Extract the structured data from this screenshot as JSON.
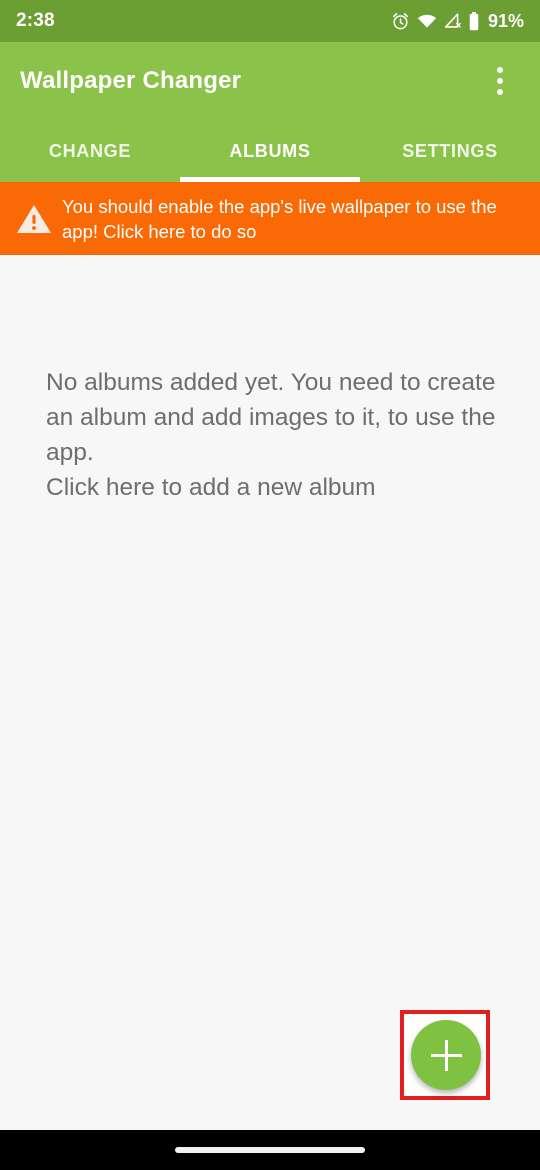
{
  "status_bar": {
    "time": "2:38",
    "battery_percent": "91%",
    "icons": [
      "alarm-icon",
      "wifi-icon",
      "cellular-no-signal-icon",
      "battery-icon"
    ],
    "background_color": "#6b9e33"
  },
  "app_bar": {
    "title": "Wallpaper Changer",
    "overflow_menu": "overflow-menu-icon",
    "background_color": "#8bc34a"
  },
  "tabs": {
    "items": [
      {
        "label": "CHANGE",
        "selected": false
      },
      {
        "label": "ALBUMS",
        "selected": true
      },
      {
        "label": "SETTINGS",
        "selected": false
      }
    ],
    "indicator_color": "#ffffff"
  },
  "banner": {
    "icon": "warning-triangle-icon",
    "text": "You should enable the app's live wallpaper to use the app! Click here to do so",
    "background_color": "#f96a06",
    "text_color": "#ffffff"
  },
  "content": {
    "empty_state_line1": "No albums added yet. You need to create an album and add images to it, to use the app.",
    "empty_state_line2": "Click here to add a new album",
    "text_color": "#6e6e6e",
    "background_color": "#f7f7f7"
  },
  "fab": {
    "icon": "plus-icon",
    "color": "#7fc242",
    "highlight_color": "#e02020",
    "highlighted": true
  },
  "nav_bar": {
    "gesture_pill": "gesture-pill",
    "background_color": "#000000"
  }
}
